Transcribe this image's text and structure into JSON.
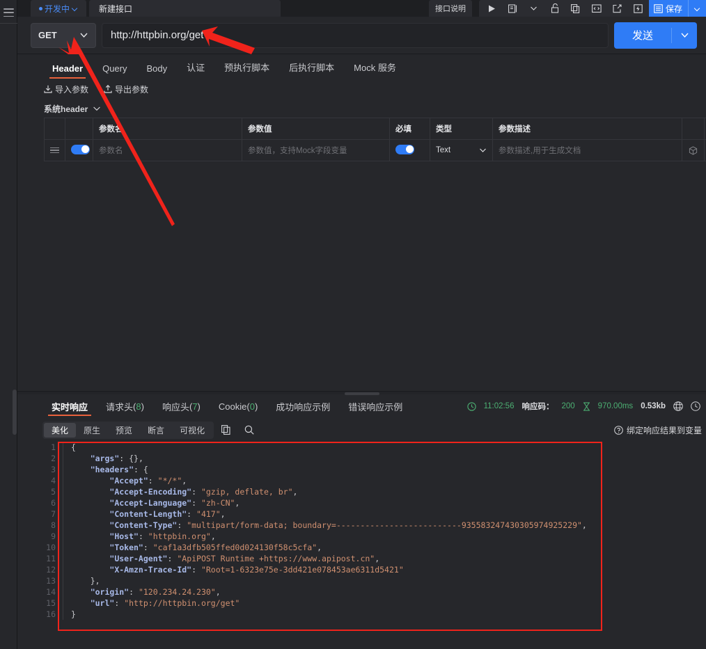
{
  "rail": {
    "menu_icon": "hamburger-icon"
  },
  "topbar": {
    "env_label": "开发中",
    "file_tab": "新建接口",
    "desc_tab": "接口说明",
    "icons": [
      "run-icon",
      "doc-icon",
      "chevron-down-icon",
      "unlock-icon",
      "copy-icon",
      "code-icon",
      "share-icon",
      "lightning-icon"
    ],
    "save_label": "保存"
  },
  "url_bar": {
    "method": "GET",
    "url": "http://httpbin.org/get",
    "send_label": "发送"
  },
  "request": {
    "tabs": [
      {
        "label": "Header",
        "active": true
      },
      {
        "label": "Query",
        "active": false
      },
      {
        "label": "Body",
        "active": false
      },
      {
        "label": "认证",
        "active": false
      },
      {
        "label": "预执行脚本",
        "active": false
      },
      {
        "label": "后执行脚本",
        "active": false
      },
      {
        "label": "Mock 服务",
        "active": false
      }
    ],
    "import_label": "导入参数",
    "export_label": "导出参数",
    "system_header_label": "系统header",
    "table": {
      "headers": [
        "",
        "",
        "参数名",
        "参数值",
        "必填",
        "类型",
        "参数描述",
        "",
        ""
      ],
      "row": {
        "name_placeholder": "参数名",
        "value_placeholder": "参数值，支持Mock字段变量",
        "type": "Text",
        "desc_placeholder": "参数描述,用于生成文档",
        "enabled": true,
        "required": true
      }
    }
  },
  "response": {
    "tabs": [
      {
        "label": "实时响应",
        "count": null,
        "active": true
      },
      {
        "label": "请求头",
        "count": "8",
        "active": false
      },
      {
        "label": "响应头",
        "count": "7",
        "active": false
      },
      {
        "label": "Cookie",
        "count": "0",
        "active": false
      },
      {
        "label": "成功响应示例",
        "count": null,
        "active": false
      },
      {
        "label": "错误响应示例",
        "count": null,
        "active": false
      }
    ],
    "status": {
      "time": "11:02:56",
      "code_label": "响应码：",
      "code": "200",
      "duration": "970.00ms",
      "size": "0.53kb"
    },
    "view_tabs": [
      {
        "label": "美化",
        "active": true
      },
      {
        "label": "原生",
        "active": false
      },
      {
        "label": "预览",
        "active": false
      },
      {
        "label": "断言",
        "active": false
      },
      {
        "label": "可视化",
        "active": false
      }
    ],
    "bind_label": "绑定响应结果到变量",
    "body": {
      "line_count": 16,
      "lines": [
        {
          "n": 1,
          "tokens": [
            {
              "t": "p",
              "v": "{"
            }
          ]
        },
        {
          "n": 2,
          "tokens": [
            {
              "t": "p",
              "v": "    "
            },
            {
              "t": "k",
              "v": "\"args\""
            },
            {
              "t": "p",
              "v": ": {},"
            }
          ]
        },
        {
          "n": 3,
          "tokens": [
            {
              "t": "p",
              "v": "    "
            },
            {
              "t": "k",
              "v": "\"headers\""
            },
            {
              "t": "p",
              "v": ": {"
            }
          ]
        },
        {
          "n": 4,
          "tokens": [
            {
              "t": "p",
              "v": "        "
            },
            {
              "t": "k",
              "v": "\"Accept\""
            },
            {
              "t": "p",
              "v": ": "
            },
            {
              "t": "s",
              "v": "\"*/*\""
            },
            {
              "t": "p",
              "v": ","
            }
          ]
        },
        {
          "n": 5,
          "tokens": [
            {
              "t": "p",
              "v": "        "
            },
            {
              "t": "k",
              "v": "\"Accept-Encoding\""
            },
            {
              "t": "p",
              "v": ": "
            },
            {
              "t": "s",
              "v": "\"gzip, deflate, br\""
            },
            {
              "t": "p",
              "v": ","
            }
          ]
        },
        {
          "n": 6,
          "tokens": [
            {
              "t": "p",
              "v": "        "
            },
            {
              "t": "k",
              "v": "\"Accept-Language\""
            },
            {
              "t": "p",
              "v": ": "
            },
            {
              "t": "s",
              "v": "\"zh-CN\""
            },
            {
              "t": "p",
              "v": ","
            }
          ]
        },
        {
          "n": 7,
          "tokens": [
            {
              "t": "p",
              "v": "        "
            },
            {
              "t": "k",
              "v": "\"Content-Length\""
            },
            {
              "t": "p",
              "v": ": "
            },
            {
              "t": "s",
              "v": "\"417\""
            },
            {
              "t": "p",
              "v": ","
            }
          ]
        },
        {
          "n": 8,
          "tokens": [
            {
              "t": "p",
              "v": "        "
            },
            {
              "t": "k",
              "v": "\"Content-Type\""
            },
            {
              "t": "p",
              "v": ": "
            },
            {
              "t": "s",
              "v": "\"multipart/form-data; boundary=--------------------------935583247430305974925229\""
            },
            {
              "t": "p",
              "v": ","
            }
          ]
        },
        {
          "n": 9,
          "tokens": [
            {
              "t": "p",
              "v": "        "
            },
            {
              "t": "k",
              "v": "\"Host\""
            },
            {
              "t": "p",
              "v": ": "
            },
            {
              "t": "s",
              "v": "\"httpbin.org\""
            },
            {
              "t": "p",
              "v": ","
            }
          ]
        },
        {
          "n": 10,
          "tokens": [
            {
              "t": "p",
              "v": "        "
            },
            {
              "t": "k",
              "v": "\"Token\""
            },
            {
              "t": "p",
              "v": ": "
            },
            {
              "t": "s",
              "v": "\"caf1a3dfb505ffed0d024130f58c5cfa\""
            },
            {
              "t": "p",
              "v": ","
            }
          ]
        },
        {
          "n": 11,
          "tokens": [
            {
              "t": "p",
              "v": "        "
            },
            {
              "t": "k",
              "v": "\"User-Agent\""
            },
            {
              "t": "p",
              "v": ": "
            },
            {
              "t": "s",
              "v": "\"ApiPOST Runtime +https://www.apipost.cn\""
            },
            {
              "t": "p",
              "v": ","
            }
          ]
        },
        {
          "n": 12,
          "tokens": [
            {
              "t": "p",
              "v": "        "
            },
            {
              "t": "k",
              "v": "\"X-Amzn-Trace-Id\""
            },
            {
              "t": "p",
              "v": ": "
            },
            {
              "t": "s",
              "v": "\"Root=1-6323e75e-3dd421e078453ae6311d5421\""
            }
          ]
        },
        {
          "n": 13,
          "tokens": [
            {
              "t": "p",
              "v": "    },"
            }
          ]
        },
        {
          "n": 14,
          "tokens": [
            {
              "t": "p",
              "v": "    "
            },
            {
              "t": "k",
              "v": "\"origin\""
            },
            {
              "t": "p",
              "v": ": "
            },
            {
              "t": "s",
              "v": "\"120.234.24.230\""
            },
            {
              "t": "p",
              "v": ","
            }
          ]
        },
        {
          "n": 15,
          "tokens": [
            {
              "t": "p",
              "v": "    "
            },
            {
              "t": "k",
              "v": "\"url\""
            },
            {
              "t": "p",
              "v": ": "
            },
            {
              "t": "s",
              "v": "\"http://httpbin.org/get\""
            }
          ]
        },
        {
          "n": 16,
          "tokens": [
            {
              "t": "p",
              "v": "}"
            }
          ]
        }
      ]
    }
  },
  "annotations": {
    "accent_red": "#f0231b",
    "arrow_1_target": "method-select",
    "arrow_2_target": "url-input",
    "highlight_box_target": "response-body-json"
  },
  "colors": {
    "accent_blue": "#2f7cf6",
    "accent_orange": "#e8613c",
    "panel_bg": "#26272b",
    "app_bg": "#1e1f22",
    "status_green": "#4caf72"
  }
}
